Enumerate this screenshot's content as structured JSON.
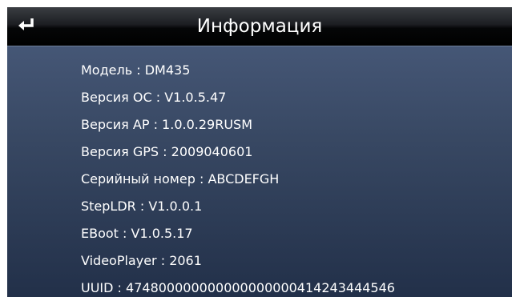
{
  "header": {
    "title": "Информация",
    "back_icon": "return-arrow-icon"
  },
  "info": [
    {
      "label": "Модель",
      "value": "DM435"
    },
    {
      "label": "Версия ОС",
      "value": "V1.0.5.47"
    },
    {
      "label": "Версия AP",
      "value": "1.0.0.29RUSM"
    },
    {
      "label": "Версия GPS",
      "value": "2009040601"
    },
    {
      "label": "Серийный номер",
      "value": "ABCDEFGH"
    },
    {
      "label": "StepLDR",
      "value": "V1.0.0.1"
    },
    {
      "label": "EBoot",
      "value": "V1.0.5.17"
    },
    {
      "label": "VideoPlayer",
      "value": "2061"
    },
    {
      "label": "UUID",
      "value": "474800000000000000000414243444546"
    }
  ],
  "separator": " : ",
  "colors": {
    "background_top": "#4b5d7e",
    "background_bottom": "#223049",
    "titlebar": "#000000",
    "text": "#ffffff"
  }
}
